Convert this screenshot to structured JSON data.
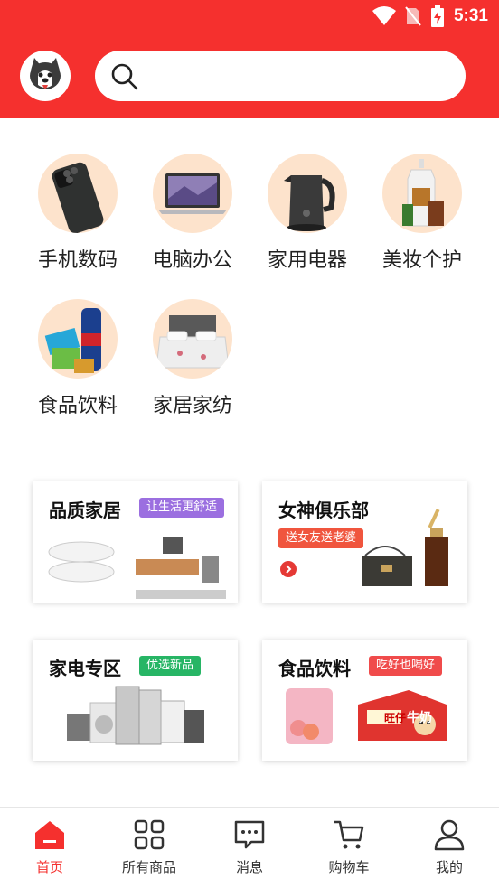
{
  "status": {
    "time": "5:31"
  },
  "search": {
    "placeholder": ""
  },
  "categories": [
    {
      "label": "手机数码",
      "icon": "phone-icon"
    },
    {
      "label": "电脑办公",
      "icon": "laptop-icon"
    },
    {
      "label": "家用电器",
      "icon": "kettle-icon"
    },
    {
      "label": "美妆个护",
      "icon": "cosmetics-icon"
    },
    {
      "label": "食品饮料",
      "icon": "drinks-icon"
    },
    {
      "label": "家居家纺",
      "icon": "bed-icon"
    }
  ],
  "promos": [
    {
      "title": "品质家居",
      "tag": "让生活更舒适",
      "tag_color": "#9b6fe0"
    },
    {
      "title": "女神俱乐部",
      "tag": "送女友送老婆",
      "tag_color": "#f0553e"
    },
    {
      "title": "家电专区",
      "tag": "优选新品",
      "tag_color": "#27b565"
    },
    {
      "title": "食品饮料",
      "tag": "吃好也喝好",
      "tag_color": "#f04b4b",
      "product_text": "牛奶",
      "product_text2": "旺仔"
    }
  ],
  "nav": [
    {
      "label": "首页",
      "icon": "home-icon",
      "active": true
    },
    {
      "label": "所有商品",
      "icon": "grid-icon",
      "active": false
    },
    {
      "label": "消息",
      "icon": "message-icon",
      "active": false
    },
    {
      "label": "购物车",
      "icon": "cart-icon",
      "active": false
    },
    {
      "label": "我的",
      "icon": "user-icon",
      "active": false
    }
  ],
  "colors": {
    "brand": "#f5302e",
    "category_bg": "#fde3cc"
  }
}
